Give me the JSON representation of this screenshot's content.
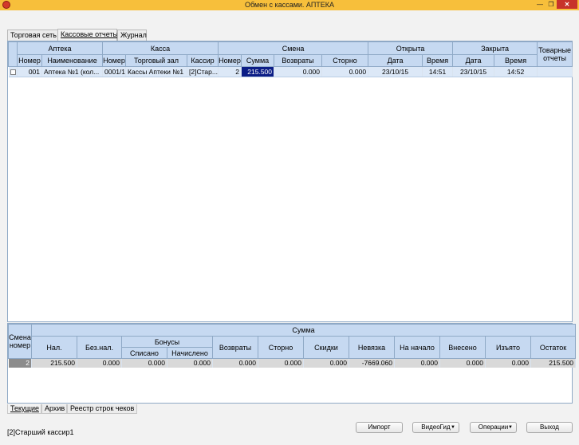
{
  "window": {
    "title": "Обмен с кассами. АПТЕКА",
    "min_glyph": "—",
    "max_glyph": "❐",
    "close_glyph": "✕"
  },
  "tabs": [
    {
      "label": "Торговая сеть",
      "active": false
    },
    {
      "label": "Кассовые отчеты",
      "active": true
    },
    {
      "label": "Журнал",
      "active": false
    }
  ],
  "top_table": {
    "groups": {
      "apteka": "Аптека",
      "kassa": "Касса",
      "smena": "Смена",
      "otkryta": "Открыта",
      "zakryta": "Закрыта",
      "tovarnye": "Товарные отчеты"
    },
    "columns": {
      "nomer": "Номер",
      "naimenovanie": "Наименование",
      "kassa_nomer": "Номер",
      "torg_zal": "Торговый зал",
      "kassir": "Кассир",
      "smena_nomer": "Номер",
      "summa": "Сумма",
      "vozvraty": "Возвраты",
      "storno": "Сторно",
      "otk_data": "Дата",
      "otk_vremya": "Время",
      "zak_data": "Дата",
      "zak_vremya": "Время"
    },
    "rows": [
      {
        "nomer": "001",
        "naimenovanie": "Аптека №1 (кол...",
        "kassa_nomer": "0001/1",
        "torg_zal": "Кассы Аптеки №1",
        "kassir": "[2]Стар...",
        "smena_nomer": "2",
        "summa": "215.500",
        "vozvraty": "0.000",
        "storno": "0.000",
        "otk_data": "23/10/15",
        "otk_vremya": "14:51",
        "zak_data": "23/10/15",
        "zak_vremya": "14:52",
        "tovarnye": ""
      }
    ]
  },
  "bottom_table": {
    "headers": {
      "smena_nomer": "Смена номер",
      "summa": "Сумма",
      "nal": "Нал.",
      "beznal": "Без.нал.",
      "bonusy": "Бонусы",
      "spisano": "Списано",
      "nachisleno": "Начислено",
      "vozvraty": "Возвраты",
      "storno": "Сторно",
      "skidki": "Скидки",
      "nevyazka": "Невязка",
      "na_nachalo": "На начало",
      "vneseno": "Внесено",
      "izyato": "Изъято",
      "ostatok": "Остаток"
    },
    "rows": [
      {
        "smena": "2",
        "nal": "215.500",
        "beznal": "0.000",
        "spisano": "0.000",
        "nachisleno": "0.000",
        "vozvraty": "0.000",
        "storno": "0.000",
        "skidki": "0.000",
        "nevyazka": "-7669.060",
        "na_nachalo": "0.000",
        "vneseno": "0.000",
        "izyato": "0.000",
        "ostatok": "215.500"
      }
    ]
  },
  "bottom_tabs": [
    {
      "label": "Текущие",
      "active": true
    },
    {
      "label": "Архив",
      "active": false
    },
    {
      "label": "Реестр строк чеков",
      "active": false
    }
  ],
  "status_bar": {
    "user": "[2]Старший кассир1"
  },
  "buttons": {
    "import": "Импорт",
    "videogid": "ВидеоГид",
    "operations": "Операции",
    "exit": "Выход",
    "dropdown_glyph": "▼"
  }
}
